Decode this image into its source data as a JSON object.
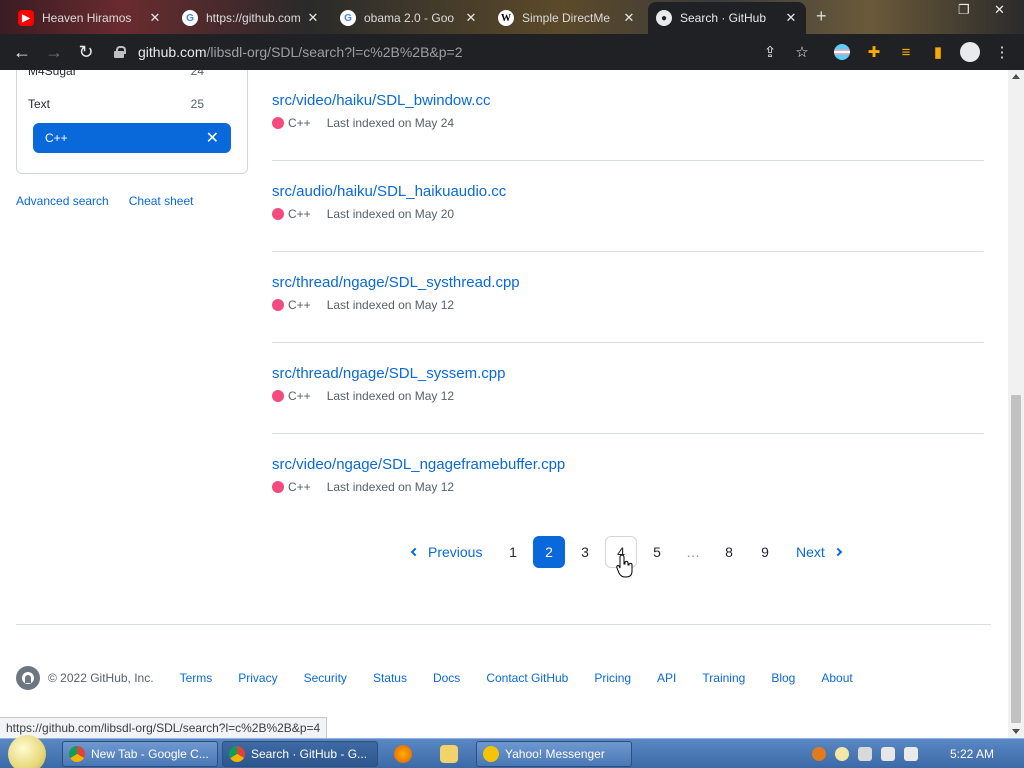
{
  "browser": {
    "tabs": [
      {
        "title": "Heaven Hiramos",
        "icon": "youtube-icon",
        "color": "#ff0000"
      },
      {
        "title": "https://github.com",
        "icon": "google-icon",
        "color": "#4285f4"
      },
      {
        "title": "obama 2.0 - Goo",
        "icon": "google-icon",
        "color": "#4285f4"
      },
      {
        "title": "Simple DirectMe",
        "icon": "wikipedia-icon",
        "color": "#ffffff"
      },
      {
        "title": "Search · GitHub",
        "icon": "github-icon",
        "color": "#ffffff"
      }
    ],
    "url_host": "github.com",
    "url_path": "/libsdl-org/SDL/search?l=c%2B%2B&p=2"
  },
  "sidebar": {
    "languages": [
      {
        "name": "M4Sugar",
        "count": "24"
      },
      {
        "name": "Text",
        "count": "25"
      },
      {
        "name": "C++",
        "count": "✕",
        "selected": true
      }
    ],
    "links": {
      "advanced": "Advanced search",
      "cheat": "Cheat sheet"
    }
  },
  "results": [
    {
      "path": "src/video/haiku/SDL_bwindow.cc",
      "lang": "C++",
      "indexed": "Last indexed on May 24"
    },
    {
      "path": "src/audio/haiku/SDL_haikuaudio.cc",
      "lang": "C++",
      "indexed": "Last indexed on May 20"
    },
    {
      "path": "src/thread/ngage/SDL_systhread.cpp",
      "lang": "C++",
      "indexed": "Last indexed on May 12"
    },
    {
      "path": "src/thread/ngage/SDL_syssem.cpp",
      "lang": "C++",
      "indexed": "Last indexed on May 12"
    },
    {
      "path": "src/video/ngage/SDL_ngageframebuffer.cpp",
      "lang": "C++",
      "indexed": "Last indexed on May 12"
    }
  ],
  "pagination": {
    "previous": "Previous",
    "pages": [
      "1",
      "2",
      "3",
      "4",
      "5",
      "…",
      "8",
      "9"
    ],
    "current": "2",
    "next": "Next"
  },
  "footer": {
    "copyright": "© 2022 GitHub, Inc.",
    "links": [
      "Terms",
      "Privacy",
      "Security",
      "Status",
      "Docs",
      "Contact GitHub",
      "Pricing",
      "API",
      "Training",
      "Blog",
      "About"
    ]
  },
  "status_url": "https://github.com/libsdl-org/SDL/search?l=c%2B%2B&p=4",
  "taskbar": {
    "tasks": [
      {
        "title": "New Tab - Google C...",
        "icon_color": "#4285f4"
      },
      {
        "title": "Search · GitHub - G...",
        "icon_color": "#4285f4"
      },
      {
        "title": "Yahoo! Messenger",
        "icon_color": "#f5c400"
      }
    ],
    "clock": "5:22 AM"
  },
  "colors": {
    "accent": "#0969da",
    "cpp": "#f34b7d"
  }
}
